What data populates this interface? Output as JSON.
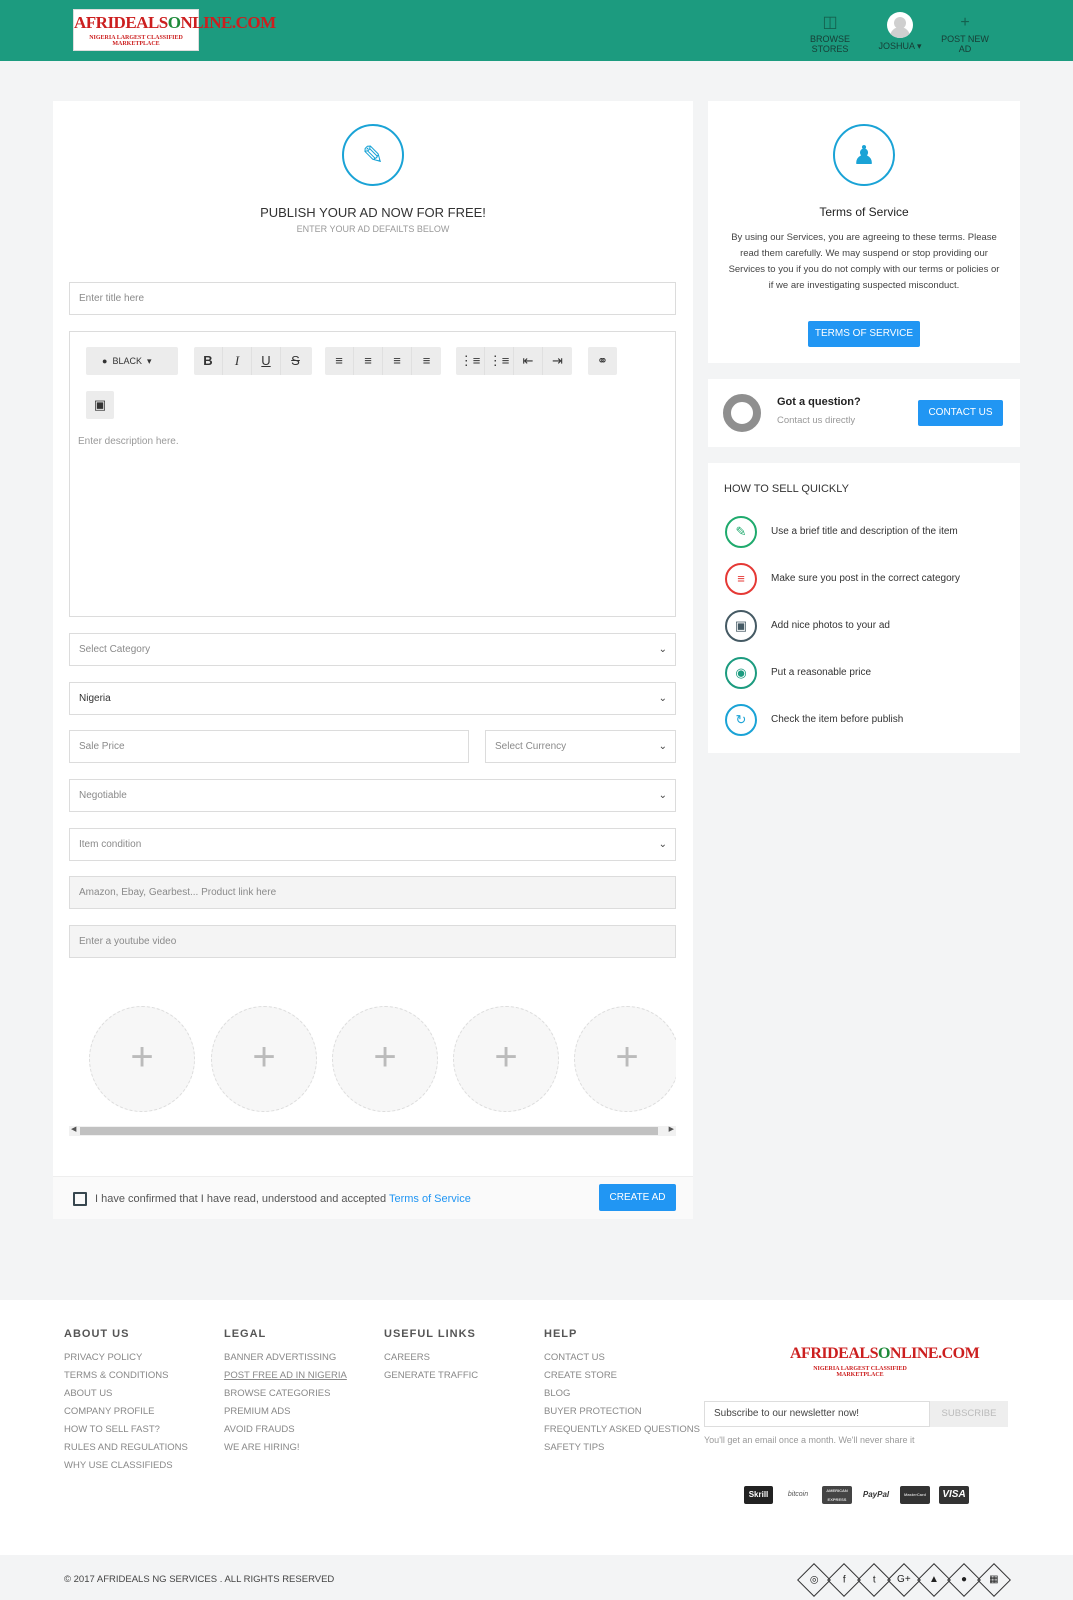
{
  "header": {
    "logo_main_a": "AFRIDEALS",
    "logo_main_b": "O",
    "logo_main_c": "NLINE.COM",
    "logo_tag": "NIGERIA LARGEST CLASSIFIED MARKETPLACE",
    "nav": [
      {
        "label": "BROWSE STORES",
        "icon": "shopping-bag-icon"
      },
      {
        "label": "JOSHUA",
        "icon": "avatar"
      },
      {
        "label": "POST NEW AD",
        "icon": "plus-icon"
      }
    ]
  },
  "post_form": {
    "heading": "PUBLISH YOUR AD NOW FOR FREE!",
    "subheading": "ENTER YOUR AD DEFAILTS BELOW",
    "title_placeholder": "Enter title here",
    "color_label": "BLACK",
    "description_placeholder": "Enter description here.",
    "category_placeholder": "Select Category",
    "country_value": "Nigeria",
    "price_placeholder": "Sale Price",
    "currency_placeholder": "Select Currency",
    "negotiable_placeholder": "Negotiable",
    "condition_placeholder": "Item condition",
    "product_link_placeholder": "Amazon, Ebay, Gearbest... Product link here",
    "youtube_placeholder": "Enter a youtube video",
    "upload_slots": [
      "+",
      "+",
      "+",
      "+",
      "+"
    ],
    "terms_text": "I have confirmed that I have read, understood and accepted",
    "terms_link": "Terms of Service",
    "create_button": "CREATE AD"
  },
  "terms_card": {
    "title": "Terms of Service",
    "body": "By using our Services, you are agreeing to these terms. Please read them carefully. We may suspend or stop providing our Services to you if you do not comply with our terms or policies or if we are investigating suspected misconduct.",
    "button": "TERMS OF SERVICE"
  },
  "question_card": {
    "title": "Got a question?",
    "subtitle": "Contact us directly",
    "button": "CONTACT US"
  },
  "sell_tips": {
    "heading": "HOW TO SELL QUICKLY",
    "items": [
      {
        "text": "Use a brief title and description of the item",
        "icon": "pencil-icon",
        "color": "#1faa6d"
      },
      {
        "text": "Make sure you post in the correct category",
        "icon": "list-icon",
        "color": "#e53935"
      },
      {
        "text": "Add nice photos to your ad",
        "icon": "image-icon",
        "color": "#455a64"
      },
      {
        "text": "Put a reasonable price",
        "icon": "money-icon",
        "color": "#1c9b7f"
      },
      {
        "text": "Check the item before publish",
        "icon": "refresh-icon",
        "color": "#1aa3d6"
      }
    ]
  },
  "footer": {
    "columns": [
      {
        "heading": "ABOUT US",
        "links": [
          "PRIVACY POLICY",
          "TERMS & CONDITIONS",
          "ABOUT US",
          "COMPANY PROFILE",
          "HOW TO SELL FAST?",
          "RULES AND REGULATIONS",
          "WHY USE CLASSIFIEDS"
        ]
      },
      {
        "heading": "LEGAL",
        "links": [
          "BANNER ADVERTISSING",
          "POST FREE AD IN NIGERIA",
          "BROWSE CATEGORIES",
          "PREMIUM ADS",
          "AVOID FRAUDS",
          "WE ARE HIRING!"
        ]
      },
      {
        "heading": "USEFUL LINKS",
        "links": [
          "CAREERS",
          "GENERATE TRAFFIC"
        ]
      },
      {
        "heading": "HELP",
        "links": [
          "CONTACT US",
          "CREATE STORE",
          "BLOG",
          "BUYER PROTECTION",
          "FREQUENTLY ASKED QUESTIONS",
          "SAFETY TIPS"
        ]
      }
    ],
    "newsletter_placeholder": "Subscribe to our newsletter now!",
    "subscribe_button": "SUBSCRIBE",
    "newsletter_note": "You'll get an email once a month. We'll never share it",
    "payments": [
      "Skrill",
      "bitcoin",
      "AMERICAN EXPRESS",
      "PayPal",
      "MasterCard",
      "VISA"
    ],
    "copyright": "© 2017 AFRIDEALS NG SERVICES . ALL RIGHTS RESERVED",
    "social_icons": [
      "globe-icon",
      "facebook-icon",
      "twitter-icon",
      "google-plus-icon",
      "android-icon",
      "apple-icon",
      "windows-icon"
    ]
  }
}
